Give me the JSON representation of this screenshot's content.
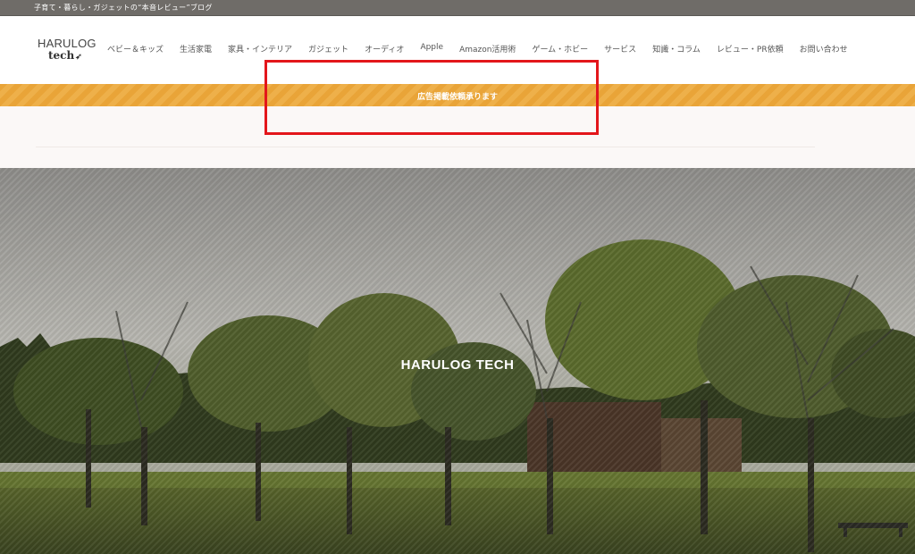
{
  "topbar": {
    "tagline": "子育て・暮らし・ガジェットの“本音レビュー”ブログ"
  },
  "logo": {
    "line1": "HARULOG",
    "line2": "tech"
  },
  "nav": [
    "ベビー＆キッズ",
    "生活家電",
    "家具・インテリア",
    "ガジェット",
    "オーディオ",
    "Apple",
    "Amazon活用術",
    "ゲーム・ホビー",
    "サービス",
    "知識・コラム",
    "レビュー・PR依頼",
    "お問い合わせ"
  ],
  "banner": {
    "text": "広告掲載依頼承ります"
  },
  "hero": {
    "title": "HARULOG TECH"
  },
  "colors": {
    "banner": "#e9a438",
    "topbar": "#6f6c68",
    "highlight": "#e3161b"
  }
}
